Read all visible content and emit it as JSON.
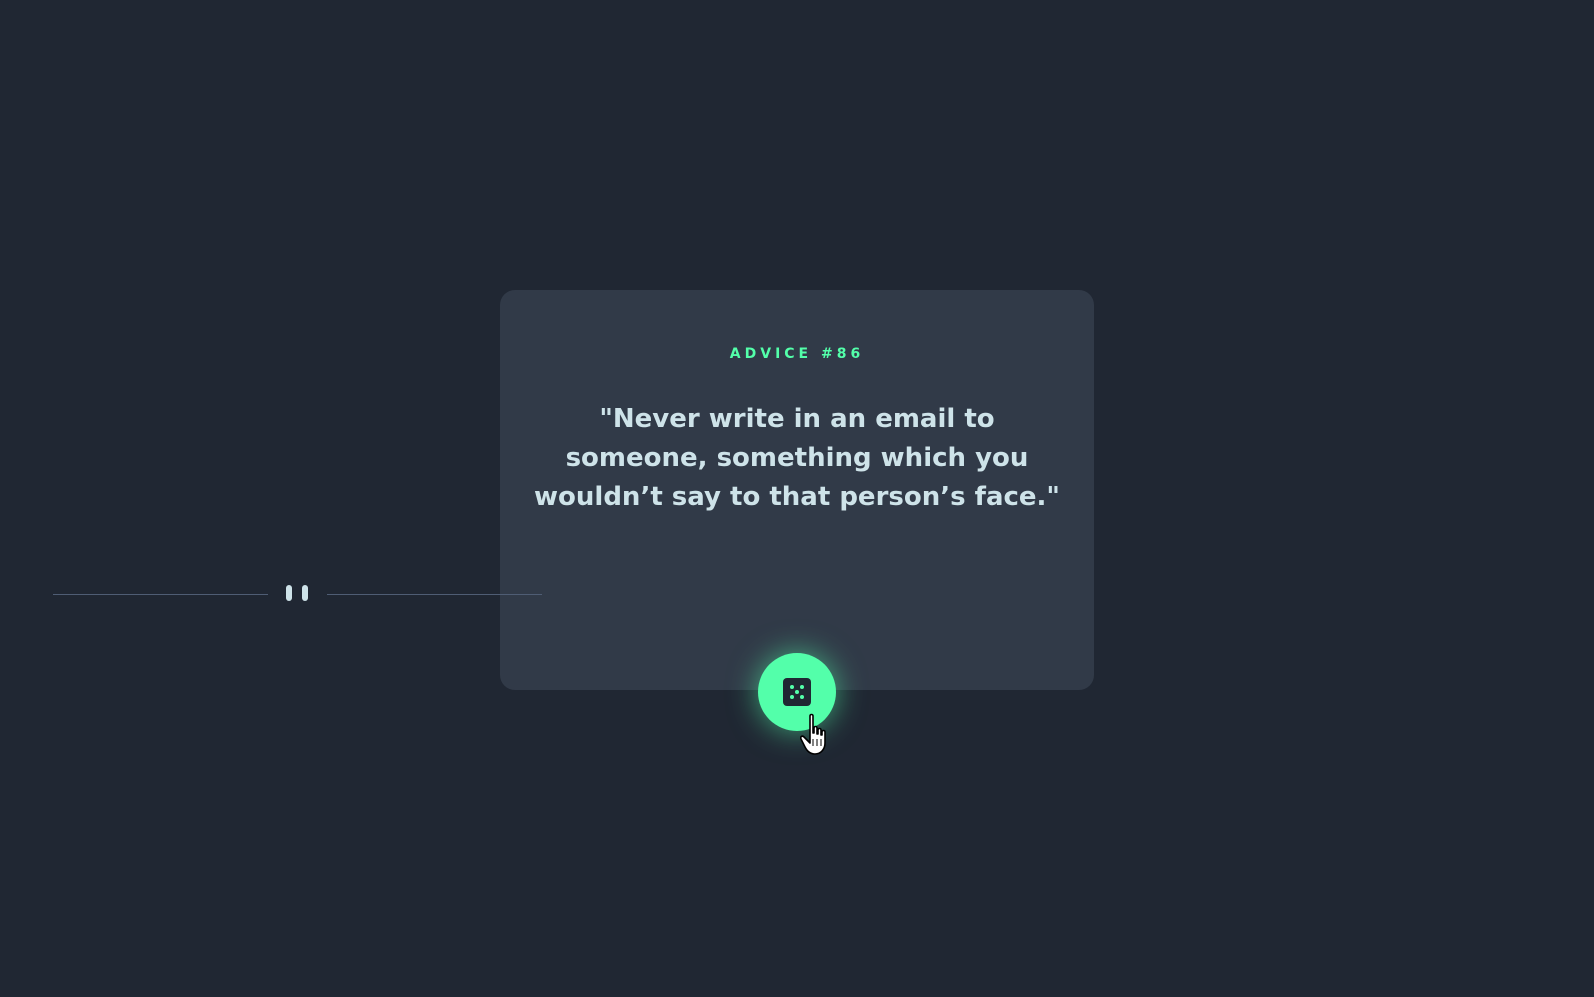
{
  "card": {
    "advice_label": "ADVICE #86",
    "advice_text": "\"Never write in an email to someone, something which you wouldn’t say to that person’s face.\""
  },
  "icons": {
    "divider": "pause-icon",
    "button": "dice-icon",
    "cursor": "hand-pointer-icon"
  },
  "colors": {
    "background": "#202733",
    "card": "#313a48",
    "accent": "#53ffaa",
    "text": "#cee3e9"
  }
}
